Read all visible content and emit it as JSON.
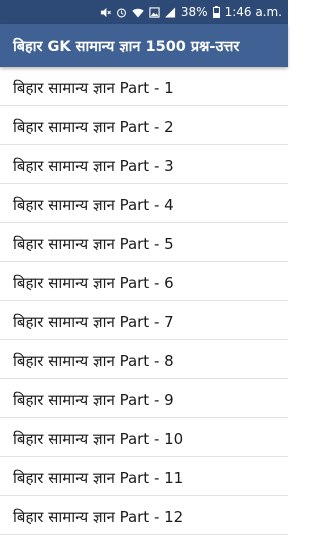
{
  "status_bar": {
    "icons": [
      "volume-off-icon",
      "alarm-icon",
      "wifi-icon",
      "image-icon",
      "signal-icon"
    ],
    "battery": "38%",
    "time": "1:46 a.m."
  },
  "app_bar": {
    "title": "बिहार GK सामान्य ज्ञान 1500 प्रश्न-उत्तर"
  },
  "list": {
    "items": [
      "बिहार सामान्य ज्ञान Part - 1",
      "बिहार सामान्य ज्ञान Part - 2",
      "बिहार सामान्य ज्ञान Part - 3",
      "बिहार सामान्य ज्ञान Part - 4",
      "बिहार सामान्य ज्ञान Part - 5",
      "बिहार सामान्य ज्ञान Part - 6",
      "बिहार सामान्य ज्ञान Part - 7",
      "बिहार सामान्य ज्ञान Part - 8",
      "बिहार सामान्य ज्ञान Part - 9",
      "बिहार सामान्य ज्ञान Part - 10",
      "बिहार सामान्य ज्ञान Part - 11",
      "बिहार सामान्य ज्ञान Part - 12"
    ]
  }
}
